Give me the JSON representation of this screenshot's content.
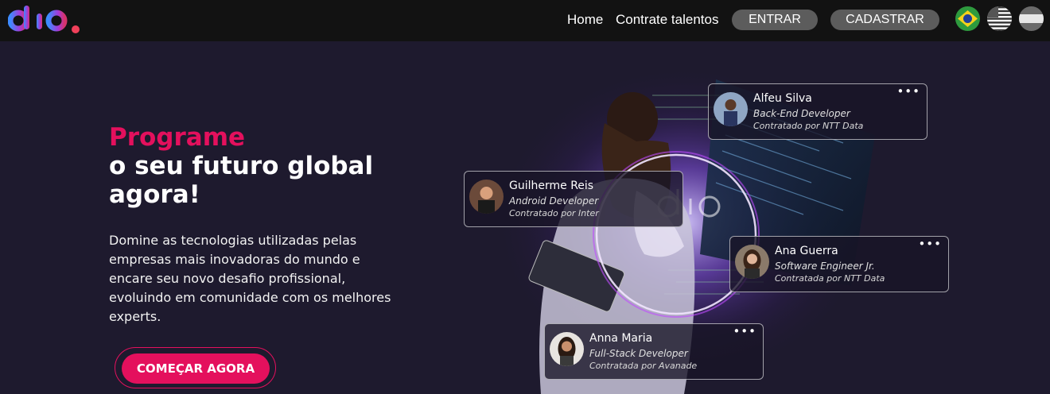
{
  "header": {
    "logo_text": "dio.",
    "nav": [
      "Home",
      "Contrate talentos"
    ],
    "login_label": "ENTRAR",
    "signup_label": "CADASTRAR",
    "languages": [
      "flag-brazil",
      "flag-usa",
      "flag-generic"
    ]
  },
  "hero": {
    "title_line1": "Programe",
    "title_line2": "o seu futuro global",
    "title_line3": "agora!",
    "description": "Domine as tecnologias utilizadas pelas empresas mais inovadoras do mundo e encare seu novo desafio profissional, evoluindo em comunidade com os melhores experts.",
    "cta_label": "COMEÇAR AGORA"
  },
  "cards": [
    {
      "name": "Alfeu Silva",
      "role": "Back-End Developer",
      "hired": "Contratado por NTT Data"
    },
    {
      "name": "Guilherme Reis",
      "role": "Android Developer",
      "hired": "Contratado por Inter"
    },
    {
      "name": "Ana Guerra",
      "role": "Software Engineer Jr.",
      "hired": "Contratada por NTT Data"
    },
    {
      "name": "Anna Maria",
      "role": "Full-Stack Developer",
      "hired": "Contratada por Avanade"
    }
  ],
  "colors": {
    "accent": "#e4105d",
    "background": "#1e1a2e",
    "topbar": "#121212",
    "pill": "#5c5c5c"
  }
}
